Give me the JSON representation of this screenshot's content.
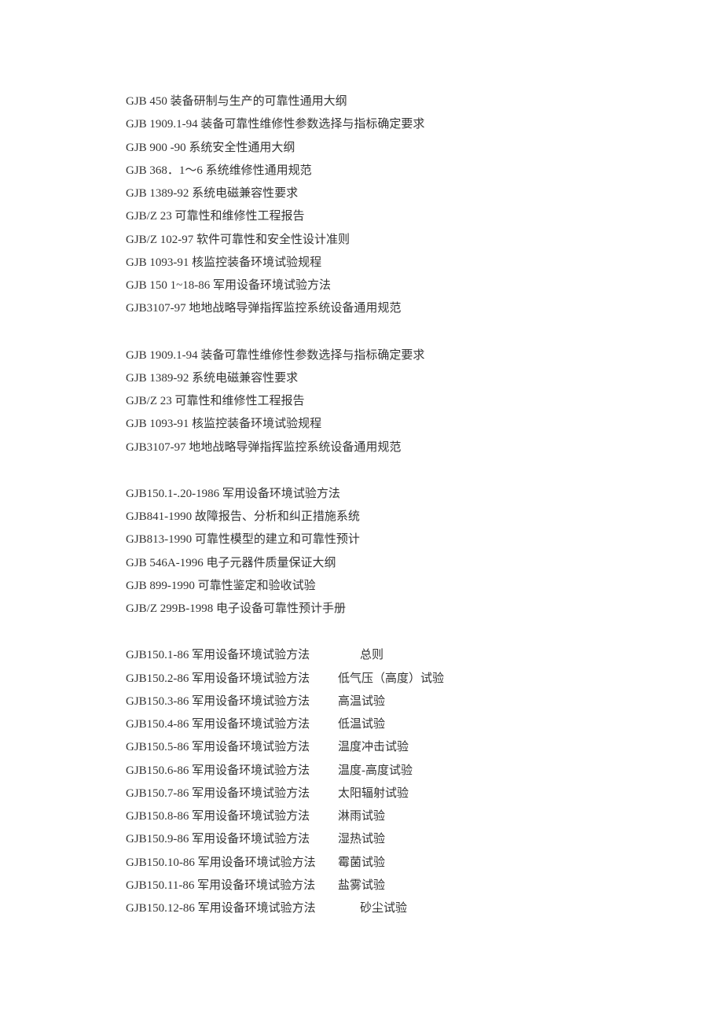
{
  "block1": [
    "GJB 450 装备研制与生产的可靠性通用大纲",
    "GJB 1909.1-94 装备可靠性维修性参数选择与指标确定要求",
    "GJB 900 -90 系统安全性通用大纲",
    "GJB 368．1～6 系统维修性通用规范",
    "GJB 1389-92 系统电磁兼容性要求",
    "GJB/Z 23 可靠性和维修性工程报告",
    "GJB/Z 102-97 软件可靠性和安全性设计准则",
    "GJB 1093-91 核监控装备环境试验规程",
    "GJB 150 1~18-86 军用设备环境试验方法",
    "GJB3107-97 地地战略导弹指挥监控系统设备通用规范"
  ],
  "block2": [
    "GJB 1909.1-94 装备可靠性维修性参数选择与指标确定要求",
    "GJB 1389-92 系统电磁兼容性要求",
    "GJB/Z 23 可靠性和维修性工程报告",
    "GJB 1093-91 核监控装备环境试验规程",
    "GJB3107-97 地地战略导弹指挥监控系统设备通用规范"
  ],
  "block3": [
    "GJB150.1-.20-1986 军用设备环境试验方法",
    "GJB841-1990 故障报告、分析和纠正措施系统",
    "GJB813-1990 可靠性模型的建立和可靠性预计",
    "GJB 546A-1996 电子元器件质量保证大纲",
    "GJB 899-1990 可靠性鉴定和验收试验",
    "GJB/Z 299B-1998 电子设备可靠性预计手册"
  ],
  "block4": [
    {
      "left": "GJB150.1-86 军用设备环境试验方法",
      "right": "总则",
      "indent": true
    },
    {
      "left": "GJB150.2-86 军用设备环境试验方法",
      "right": "低气压（高度）试验",
      "indent": false
    },
    {
      "left": "GJB150.3-86 军用设备环境试验方法",
      "right": "高温试验",
      "indent": false
    },
    {
      "left": "GJB150.4-86 军用设备环境试验方法",
      "right": "低温试验",
      "indent": false
    },
    {
      "left": "GJB150.5-86 军用设备环境试验方法",
      "right": "温度冲击试验",
      "indent": false
    },
    {
      "left": "GJB150.6-86 军用设备环境试验方法",
      "right": "温度-高度试验",
      "indent": false
    },
    {
      "left": "GJB150.7-86 军用设备环境试验方法",
      "right": "太阳辐射试验",
      "indent": false
    },
    {
      "left": "GJB150.8-86 军用设备环境试验方法",
      "right": "淋雨试验",
      "indent": false
    },
    {
      "left": "GJB150.9-86 军用设备环境试验方法",
      "right": "湿热试验",
      "indent": false
    },
    {
      "left": "GJB150.10-86 军用设备环境试验方法",
      "right": "霉菌试验",
      "indent": false
    },
    {
      "left": "GJB150.11-86 军用设备环境试验方法",
      "right": "盐雾试验",
      "indent": false
    },
    {
      "left": "GJB150.12-86 军用设备环境试验方法",
      "right": "砂尘试验",
      "indent": true
    }
  ]
}
